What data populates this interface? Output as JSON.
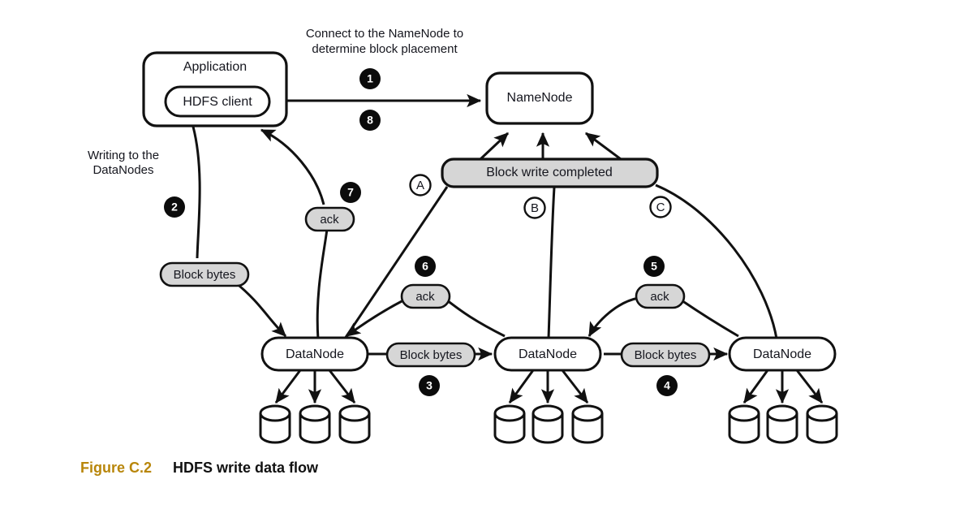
{
  "figure": {
    "caption_number": "Figure C.2",
    "caption_title": "HDFS write data flow"
  },
  "annotations": {
    "top_note_line1": "Connect to the NameNode to",
    "top_note_line2": "determine block placement",
    "left_note_line1": "Writing to the",
    "left_note_line2": "DataNodes"
  },
  "nodes": {
    "application": "Application",
    "hdfs_client": "HDFS client",
    "namenode": "NameNode",
    "block_write_completed": "Block write completed",
    "datanode_1": "DataNode",
    "datanode_2": "DataNode",
    "datanode_3": "DataNode"
  },
  "pills": {
    "block_bytes_1": "Block bytes",
    "block_bytes_2": "Block bytes",
    "block_bytes_3": "Block bytes",
    "ack_7": "ack",
    "ack_6": "ack",
    "ack_5": "ack"
  },
  "step_badges": [
    {
      "id": "step-1",
      "label": "1"
    },
    {
      "id": "step-2",
      "label": "2"
    },
    {
      "id": "step-3",
      "label": "3"
    },
    {
      "id": "step-4",
      "label": "4"
    },
    {
      "id": "step-5",
      "label": "5"
    },
    {
      "id": "step-6",
      "label": "6"
    },
    {
      "id": "step-7",
      "label": "7"
    },
    {
      "id": "step-8",
      "label": "8"
    }
  ],
  "letter_badges": [
    {
      "id": "letter-a",
      "label": "A"
    },
    {
      "id": "letter-b",
      "label": "B"
    },
    {
      "id": "letter-c",
      "label": "C"
    }
  ],
  "colors": {
    "caption_number": "#b8860b",
    "stroke": "#111111",
    "pill_fill": "#d6d6d6",
    "node_fill": "#ffffff",
    "badge_fill": "#0b0b0b",
    "text": "#15161e"
  }
}
